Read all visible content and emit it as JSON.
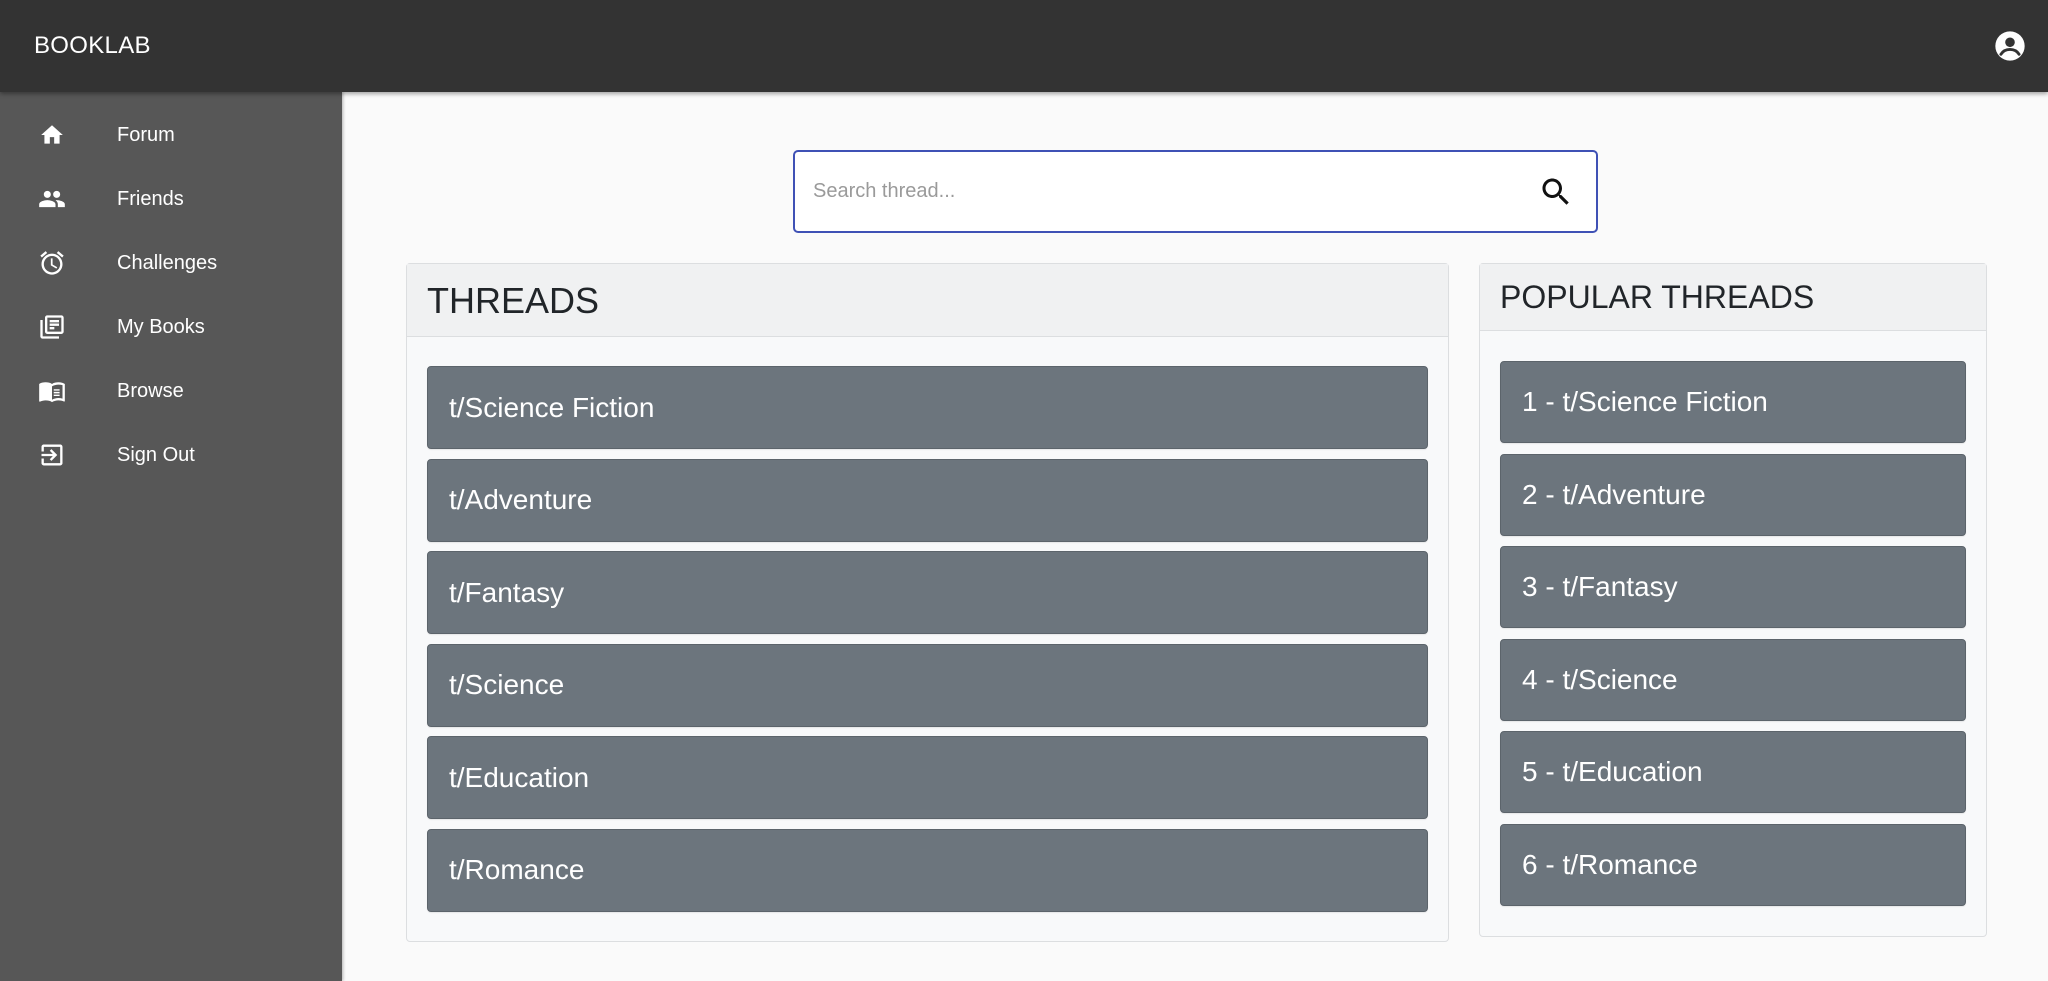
{
  "app": {
    "brand": "BOOKLAB"
  },
  "sidebar": {
    "items": [
      {
        "label": "Forum",
        "icon": "home-icon"
      },
      {
        "label": "Friends",
        "icon": "people-icon"
      },
      {
        "label": "Challenges",
        "icon": "alarm-icon"
      },
      {
        "label": "My Books",
        "icon": "library-books-icon"
      },
      {
        "label": "Browse",
        "icon": "open-book-icon"
      },
      {
        "label": "Sign Out",
        "icon": "sign-out-icon"
      }
    ]
  },
  "search": {
    "placeholder": "Search thread...",
    "value": ""
  },
  "threads": {
    "title": "THREADS",
    "items": [
      "t/Science Fiction",
      "t/Adventure",
      "t/Fantasy",
      "t/Science",
      "t/Education",
      "t/Romance"
    ]
  },
  "popular": {
    "title": "POPULAR THREADS",
    "items": [
      "1 - t/Science Fiction",
      "2 - t/Adventure",
      "3 - t/Fantasy",
      "4 - t/Science",
      "5 - t/Education",
      "6 - t/Romance"
    ]
  },
  "colors": {
    "appbar": "#333333",
    "sidebar": "#575757",
    "accent": "#3f51b5",
    "thread_button": "#6c757d"
  }
}
